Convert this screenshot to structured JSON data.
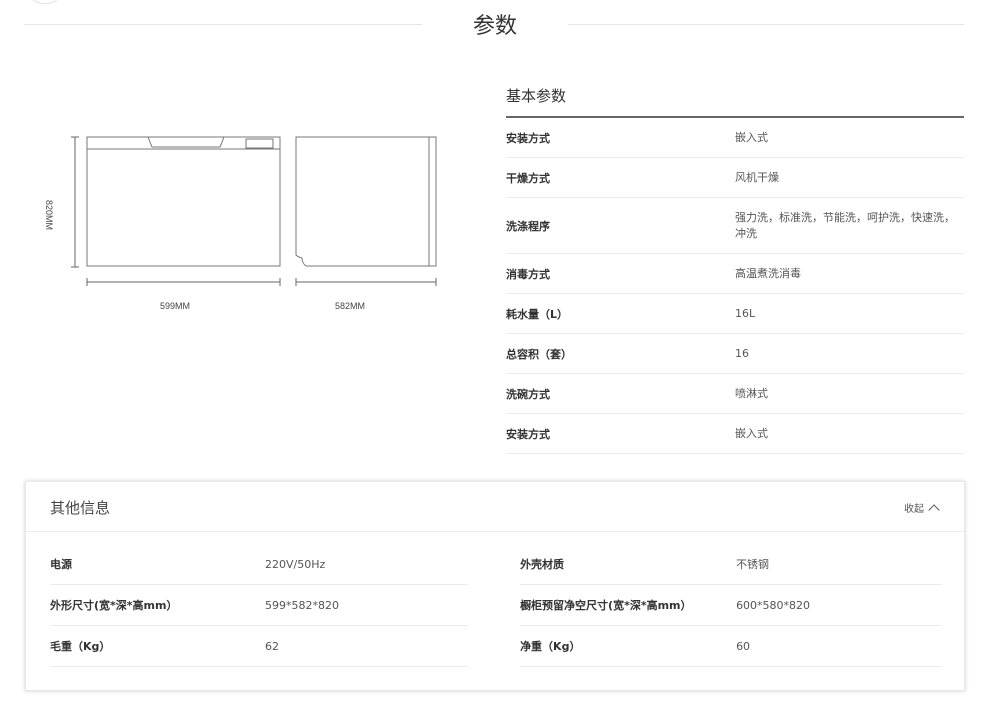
{
  "section": {
    "title": "参数"
  },
  "diagram": {
    "height_label": "820MM",
    "width_label": "599MM",
    "depth_label": "582MM"
  },
  "basic": {
    "title": "基本参数",
    "rows": [
      {
        "key": "安装方式",
        "value": "嵌入式"
      },
      {
        "key": "干燥方式",
        "value": "风机干燥"
      },
      {
        "key": "洗涤程序",
        "value": "强力洗，标准洗，节能洗，呵护洗，快速洗，冲洗"
      },
      {
        "key": "消毒方式",
        "value": "高温煮洗消毒"
      },
      {
        "key": "耗水量（L）",
        "value": "16L"
      },
      {
        "key": "总容积（套）",
        "value": "16"
      },
      {
        "key": "洗碗方式",
        "value": "喷淋式"
      },
      {
        "key": "安装方式",
        "value": "嵌入式"
      }
    ]
  },
  "other": {
    "title": "其他信息",
    "collapse_label": "收起",
    "left_rows": [
      {
        "key": "电源",
        "value": "220V/50Hz"
      },
      {
        "key": "外形尺寸(宽*深*高mm）",
        "value": "599*582*820"
      },
      {
        "key": "毛重（Kg）",
        "value": "62"
      }
    ],
    "right_rows": [
      {
        "key": "外壳材质",
        "value": "不锈钢"
      },
      {
        "key": "橱柜预留净空尺寸(宽*深*高mm）",
        "value": "600*580*820"
      },
      {
        "key": "净重（Kg）",
        "value": "60"
      }
    ]
  }
}
